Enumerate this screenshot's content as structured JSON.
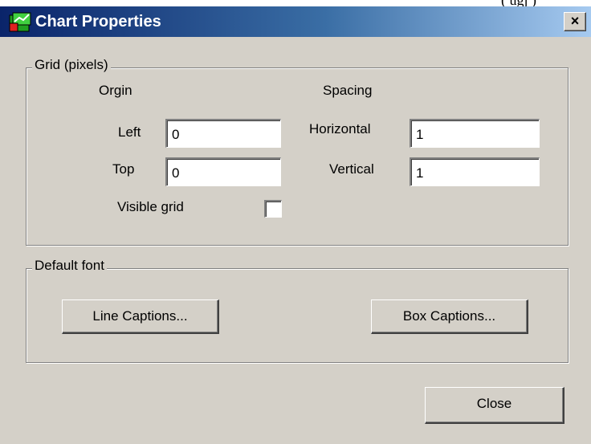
{
  "edge_text": "(  ugj  )",
  "window": {
    "title": "Chart Properties",
    "close_glyph": "×"
  },
  "grid_group": {
    "label": "Grid (pixels)",
    "origin_header": "Orgin",
    "spacing_header": "Spacing",
    "left_label": "Left",
    "left_value": "0",
    "top_label": "Top",
    "top_value": "0",
    "horizontal_label": "Horizontal",
    "horizontal_value": "1",
    "vertical_label": "Vertical",
    "vertical_value": "1",
    "visible_grid_label": "Visible grid",
    "visible_grid_checked": false
  },
  "font_group": {
    "label": "Default font",
    "line_captions_button": "Line Captions...",
    "box_captions_button": "Box Captions..."
  },
  "close_button": "Close",
  "icons": {
    "app": "chart-icon",
    "close": "close-icon"
  },
  "colors": {
    "title_start": "#0a246a",
    "title_end": "#a6caf0",
    "dialog_face": "#d4d0c8"
  }
}
